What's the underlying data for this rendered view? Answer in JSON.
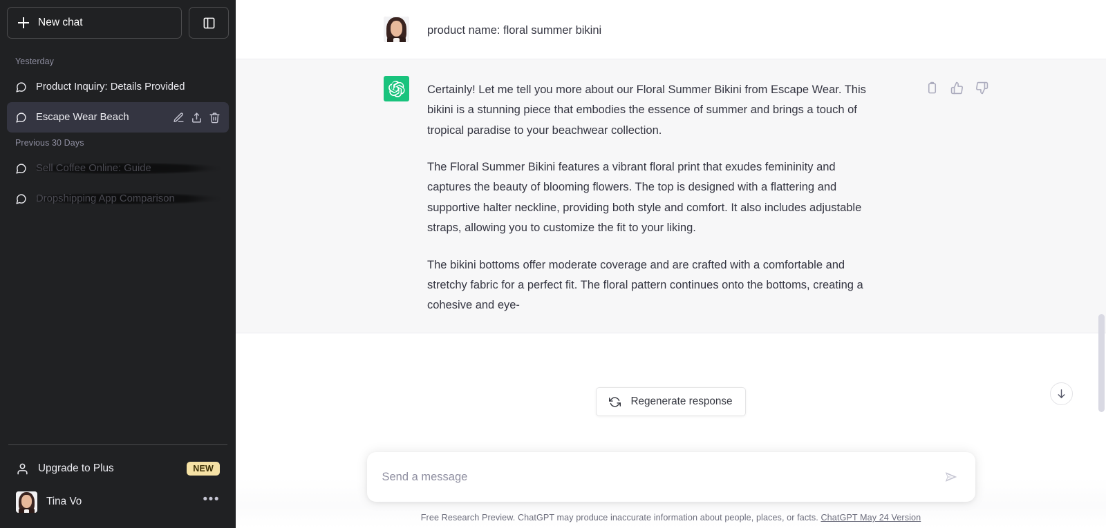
{
  "sidebar": {
    "new_chat_label": "New chat",
    "collapse_icon": "sidebar-toggle-icon",
    "sections": [
      {
        "label": "Yesterday",
        "items": [
          {
            "title": "Product Inquiry: Details Provided",
            "active": false,
            "dimmed": false
          },
          {
            "title": "Escape Wear Beach",
            "active": true,
            "dimmed": false
          }
        ]
      },
      {
        "label": "Previous 30 Days",
        "items": [
          {
            "title": "Sell Coffee Online: Guide",
            "active": false,
            "dimmed": true
          },
          {
            "title": "Dropshipping App Comparison",
            "active": false,
            "dimmed": true
          }
        ]
      }
    ],
    "item_actions": {
      "edit": "edit-icon",
      "share": "share-icon",
      "delete": "trash-icon"
    },
    "upgrade": {
      "label": "Upgrade to Plus",
      "badge": "NEW",
      "badge_color": "#f6e2a5"
    },
    "account": {
      "name": "Tina Vo",
      "menu_glyph": "•••"
    }
  },
  "conversation": {
    "messages": [
      {
        "role": "user",
        "avatar": "user-avatar",
        "paragraphs": [
          "product name: floral summer bikini"
        ]
      },
      {
        "role": "assistant",
        "avatar": "chatgpt-logo",
        "paragraphs": [
          "Certainly! Let me tell you more about our Floral Summer Bikini from Escape Wear. This bikini is a stunning piece that embodies the essence of summer and brings a touch of tropical paradise to your beachwear collection.",
          "The Floral Summer Bikini features a vibrant floral print that exudes femininity and captures the beauty of blooming flowers. The top is designed with a flattering and supportive halter neckline, providing both style and comfort. It also includes adjustable straps, allowing you to customize the fit to your liking.",
          "The bikini bottoms offer moderate coverage and are crafted with a comfortable and stretchy fabric for a perfect fit. The floral pattern continues onto the bottoms, creating a cohesive and eye-"
        ],
        "actions": [
          "copy-icon",
          "thumbs-up-icon",
          "thumbs-down-icon"
        ]
      }
    ]
  },
  "regenerate": {
    "label": "Regenerate response",
    "icon": "refresh-icon"
  },
  "scroll_button": {
    "icon": "arrow-down-icon"
  },
  "composer": {
    "placeholder": "Send a message",
    "value": "",
    "send_icon": "send-icon"
  },
  "footer": {
    "text": "Free Research Preview. ChatGPT may produce inaccurate information about people, places, or facts.",
    "link": "ChatGPT May 24 Version"
  },
  "colors": {
    "sidebar_bg": "#202123",
    "active_item": "#343541",
    "assistant_bg": "#f7f7f8",
    "brand_green": "#19c37d",
    "badge_yellow": "#f6e2a5"
  }
}
